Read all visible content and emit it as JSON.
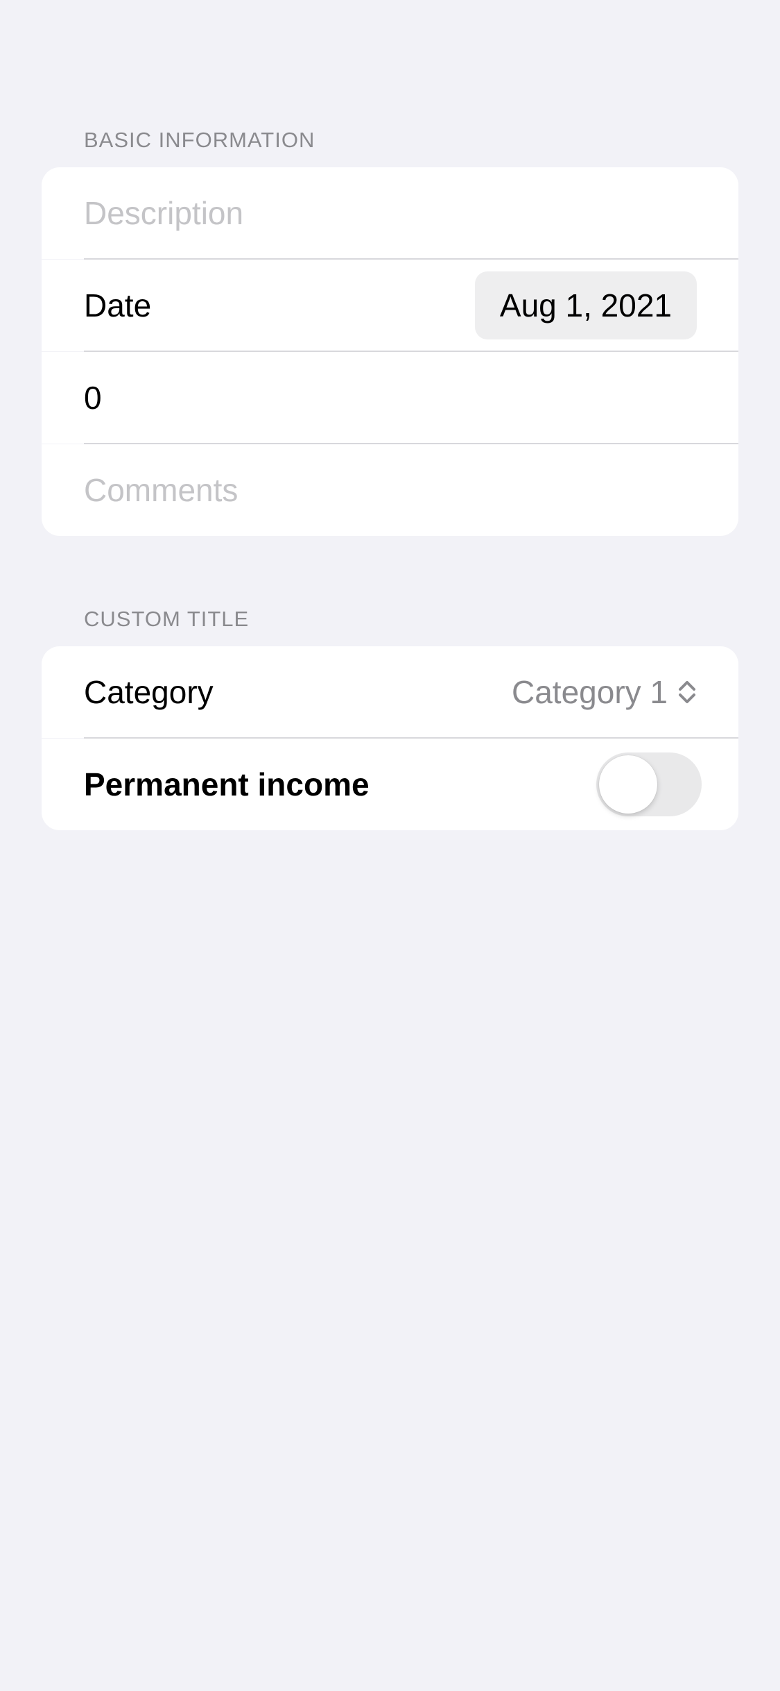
{
  "basic_section": {
    "header": "BASIC INFORMATION",
    "description_placeholder": "Description",
    "date_label": "Date",
    "date_value": "Aug 1, 2021",
    "amount_value": "0",
    "comments_placeholder": "Comments"
  },
  "custom_section": {
    "header": "CUSTOM TITLE",
    "category_label": "Category",
    "category_value": "Category 1",
    "permanent_income_label": "Permanent income",
    "permanent_income_on": false
  },
  "icons": {
    "category_picker": "chevron-up-down-icon"
  },
  "colors": {
    "background": "#F2F2F7",
    "card": "#FFFFFF",
    "secondary_text": "#8A8A8E",
    "placeholder": "#C4C4C7",
    "toggle_off": "#E9E9EA"
  }
}
